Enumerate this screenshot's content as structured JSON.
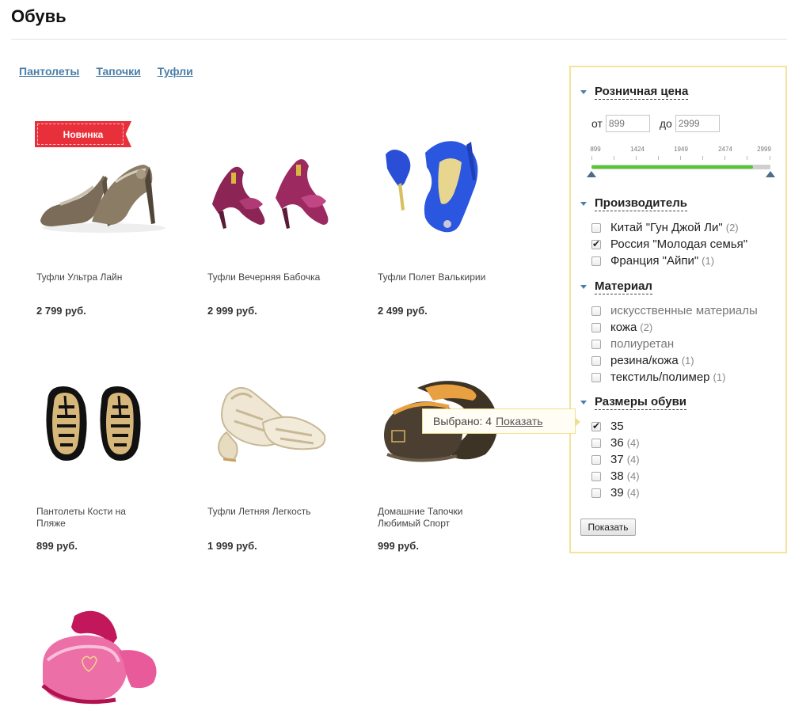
{
  "page": {
    "title": "Обувь"
  },
  "subcategories": [
    "Пантолеты",
    "Тапочки",
    "Туфли"
  ],
  "badge": {
    "label": "Новинка"
  },
  "products": [
    {
      "name": "Туфли Ультра Лайн",
      "price": "2 799 руб.",
      "image": "pumps-bronze"
    },
    {
      "name": "Туфли Вечерняя Бабочка",
      "price": "2 999 руб.",
      "image": "slingback-purple"
    },
    {
      "name": "Туфли Полет Валькирии",
      "price": "2 499 руб.",
      "image": "sandal-blue"
    },
    {
      "name": "Пантолеты Кости на Пляже",
      "price": "899 руб.",
      "image": "flipflops-bones"
    },
    {
      "name": "Туфли Летняя Легкость",
      "price": "1 999 руб.",
      "image": "sandals-white"
    },
    {
      "name": "Домашние Тапочки Любимый Спорт",
      "price": "999 руб.",
      "image": "slippers-brown"
    },
    {
      "name": "",
      "price": "",
      "image": "slippers-pink"
    }
  ],
  "filter": {
    "price": {
      "title": "Розничная цена",
      "from_label": "от",
      "to_label": "до",
      "from_placeholder": "899",
      "to_placeholder": "2999",
      "ticks": [
        "899",
        "1424",
        "1949",
        "2474",
        "2999"
      ],
      "range_min": 899,
      "range_max": 2999,
      "selected_min": 899,
      "selected_max": 2999
    },
    "manufacturer": {
      "title": "Производитель",
      "options": [
        {
          "label": "Китай \"Гун Джой Ли\"",
          "count": "(2)",
          "checked": false
        },
        {
          "label": "Россия \"Молодая семья\"",
          "count": "",
          "checked": true
        },
        {
          "label": "Франция \"Айпи\"",
          "count": "(1)",
          "checked": false
        }
      ]
    },
    "material": {
      "title": "Материал",
      "options": [
        {
          "label": "искусственные материалы",
          "count": "",
          "checked": false,
          "dim": true
        },
        {
          "label": "кожа",
          "count": "(2)",
          "checked": false,
          "dim": false
        },
        {
          "label": "полиуретан",
          "count": "",
          "checked": false,
          "dim": true
        },
        {
          "label": "резина/кожа",
          "count": "(1)",
          "checked": false,
          "dim": false
        },
        {
          "label": "текстиль/полимер",
          "count": "(1)",
          "checked": false,
          "dim": false
        }
      ]
    },
    "sizes": {
      "title": "Размеры обуви",
      "options": [
        {
          "label": "35",
          "count": "",
          "checked": true
        },
        {
          "label": "36",
          "count": "(4)",
          "checked": false
        },
        {
          "label": "37",
          "count": "(4)",
          "checked": false
        },
        {
          "label": "38",
          "count": "(4)",
          "checked": false
        },
        {
          "label": "39",
          "count": "(4)",
          "checked": false
        }
      ]
    },
    "tooltip": {
      "text": "Выбрано: 4",
      "link": "Показать"
    },
    "submit_label": "Показать"
  },
  "colors": {
    "link": "#4a7ea8",
    "badge": "#e8303a",
    "filter_border": "#f5e39a",
    "slider_fill": "#53c82f"
  }
}
